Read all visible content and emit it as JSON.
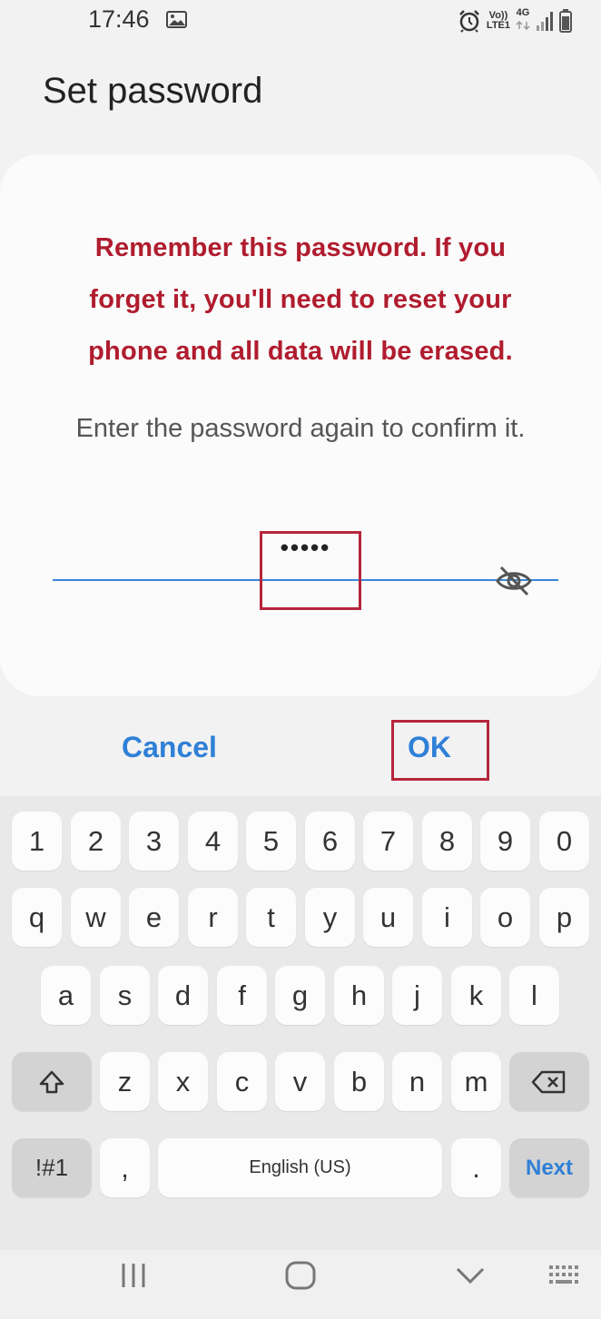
{
  "status_bar": {
    "time": "17:46",
    "network_top": "Vo)) ",
    "network_bottom": "LTE1",
    "net_type": "4G",
    "icons": [
      "gallery-icon",
      "alarm-icon",
      "signal-icon",
      "battery-icon"
    ]
  },
  "header": {
    "title": "Set password"
  },
  "dialog": {
    "warning": "Remember this password. If you forget it, you'll need to reset your phone and all data will be erased.",
    "prompt": "Enter the password again to confirm it.",
    "password_value": "•••••",
    "visibility_icon": "eye-off-icon",
    "cancel_label": "Cancel",
    "ok_label": "OK"
  },
  "keyboard": {
    "row_numbers": [
      "1",
      "2",
      "3",
      "4",
      "5",
      "6",
      "7",
      "8",
      "9",
      "0"
    ],
    "row_q": [
      "q",
      "w",
      "e",
      "r",
      "t",
      "y",
      "u",
      "i",
      "o",
      "p"
    ],
    "row_a": [
      "a",
      "s",
      "d",
      "f",
      "g",
      "h",
      "j",
      "k",
      "l"
    ],
    "row_z": [
      "z",
      "x",
      "c",
      "v",
      "b",
      "n",
      "m"
    ],
    "symbols_label": "!#1",
    "comma_label": ",",
    "space_label": "English (US)",
    "period_label": ".",
    "next_label": "Next",
    "shift_icon": "shift-icon",
    "backspace_icon": "backspace-icon"
  },
  "navbar": {
    "icons": [
      "recents-icon",
      "home-icon",
      "back-icon",
      "keyboard-switch-icon"
    ]
  },
  "colors": {
    "accent": "#2f80d6",
    "warning": "#b01c2e",
    "highlight": "#b5263c"
  }
}
